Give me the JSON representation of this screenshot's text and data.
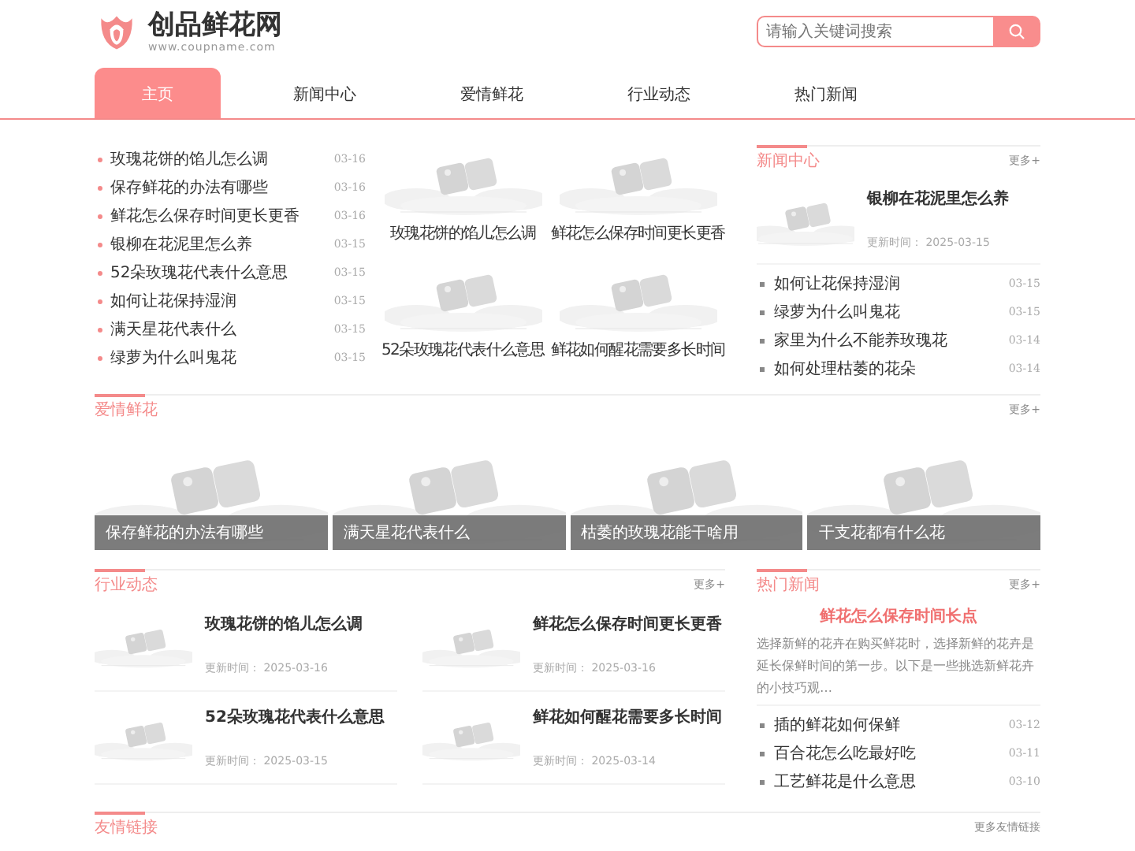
{
  "header": {
    "site_name": "创品鲜花网",
    "site_url": "www.coupname.com",
    "search": {
      "placeholder": "请输入关键词搜索"
    }
  },
  "nav": [
    {
      "label": "主页",
      "selected": true
    },
    {
      "label": "新闻中心",
      "selected": false
    },
    {
      "label": "爱情鲜花",
      "selected": false
    },
    {
      "label": "行业动态",
      "selected": false
    },
    {
      "label": "热门新闻",
      "selected": false
    }
  ],
  "top_list": [
    {
      "title": "玫瑰花饼的馅儿怎么调",
      "date": "03-16"
    },
    {
      "title": "保存鲜花的办法有哪些",
      "date": "03-16"
    },
    {
      "title": "鲜花怎么保存时间更长更香",
      "date": "03-16"
    },
    {
      "title": "银柳在花泥里怎么养",
      "date": "03-15"
    },
    {
      "title": "52朵玫瑰花代表什么意思",
      "date": "03-15"
    },
    {
      "title": "如何让花保持湿润",
      "date": "03-15"
    },
    {
      "title": "满天星花代表什么",
      "date": "03-15"
    },
    {
      "title": "绿萝为什么叫鬼花",
      "date": "03-15"
    }
  ],
  "image_grid": [
    {
      "caption": "玫瑰花饼的馅儿怎么调"
    },
    {
      "caption": "鲜花怎么保存时间更长更香"
    },
    {
      "caption": "52朵玫瑰花代表什么意思"
    },
    {
      "caption": "鲜花如何醒花需要多长时间"
    }
  ],
  "news_center": {
    "title": "新闻中心",
    "more": "更多+",
    "feature": {
      "title": "银柳在花泥里怎么养",
      "updated": "更新时间： 2025-03-15"
    },
    "items": [
      {
        "title": "如何让花保持湿润",
        "date": "03-15"
      },
      {
        "title": "绿萝为什么叫鬼花",
        "date": "03-15"
      },
      {
        "title": "家里为什么不能养玫瑰花",
        "date": "03-14"
      },
      {
        "title": "如何处理枯萎的花朵",
        "date": "03-14"
      }
    ]
  },
  "love_flowers": {
    "title": "爱情鲜花",
    "more": "更多+",
    "cards": [
      {
        "caption": "保存鲜花的办法有哪些"
      },
      {
        "caption": "满天星花代表什么"
      },
      {
        "caption": "枯萎的玫瑰花能干啥用"
      },
      {
        "caption": "干支花都有什么花"
      }
    ]
  },
  "industry": {
    "title": "行业动态",
    "more": "更多+",
    "items": [
      {
        "title": "玫瑰花饼的馅儿怎么调",
        "updated": "更新时间： 2025-03-16"
      },
      {
        "title": "鲜花怎么保存时间更长更香",
        "updated": "更新时间： 2025-03-16"
      },
      {
        "title": "52朵玫瑰花代表什么意思",
        "updated": "更新时间： 2025-03-15"
      },
      {
        "title": "鲜花如何醒花需要多长时间",
        "updated": "更新时间： 2025-03-14"
      }
    ]
  },
  "hot_news": {
    "title": "热门新闻",
    "more": "更多+",
    "headline": "鲜花怎么保存时间长点",
    "summary": "选择新鲜的花卉在购买鲜花时，选择新鲜的花卉是延长保鲜时间的第一步。以下是一些挑选新鲜花卉的小技巧观…",
    "items": [
      {
        "title": "插的鲜花如何保鲜",
        "date": "03-12"
      },
      {
        "title": "百合花怎么吃最好吃",
        "date": "03-11"
      },
      {
        "title": "工艺鲜花是什么意思",
        "date": "03-10"
      }
    ]
  },
  "links": {
    "title": "友情链接",
    "more": "更多友情链接"
  }
}
